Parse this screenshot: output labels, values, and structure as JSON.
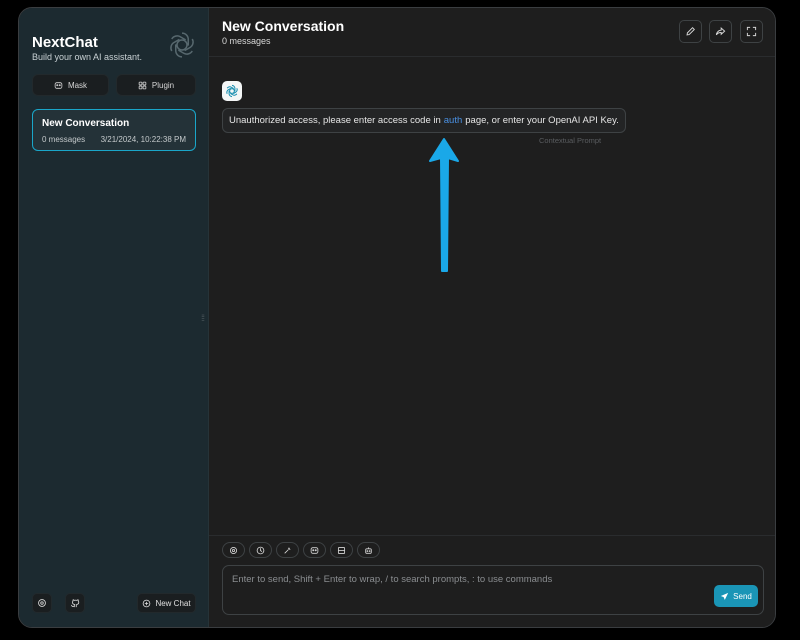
{
  "sidebar": {
    "title": "NextChat",
    "subtitle": "Build your own AI assistant.",
    "logo_icon": "openai-logo-icon",
    "mask_label": "Mask",
    "plugin_label": "Plugin",
    "chats": [
      {
        "title": "New Conversation",
        "count": "0 messages",
        "time": "3/21/2024, 10:22:38 PM"
      }
    ],
    "new_chat_label": "New Chat",
    "footer_icons": [
      "settings-icon",
      "github-icon"
    ]
  },
  "header": {
    "title": "New Conversation",
    "subtitle": "0 messages",
    "buttons": [
      "edit-icon",
      "share-icon",
      "maximize-icon"
    ]
  },
  "messages": [
    {
      "role": "bot",
      "text_before": "Unauthorized access, please enter access code in",
      "link_text": "auth",
      "text_after": "page, or enter your OpenAI API Key.",
      "date": "Contextual Prompt"
    }
  ],
  "annotation": {
    "arrow_color": "#1aa8e8"
  },
  "input": {
    "placeholder": "Enter to send, Shift + Enter to wrap, / to search prompts, : to use commands",
    "value": "",
    "send_label": "Send",
    "tools": [
      "settings-icon",
      "theme-icon",
      "prompt-icon",
      "mask-icon",
      "clear-context-icon",
      "robot-icon"
    ]
  },
  "colors": {
    "accent": "#1a95b6",
    "active_border": "#1aa6c9",
    "sidebar_bg": "#1c2a30",
    "main_bg": "#1e1e1e",
    "link": "#4a90e2"
  }
}
